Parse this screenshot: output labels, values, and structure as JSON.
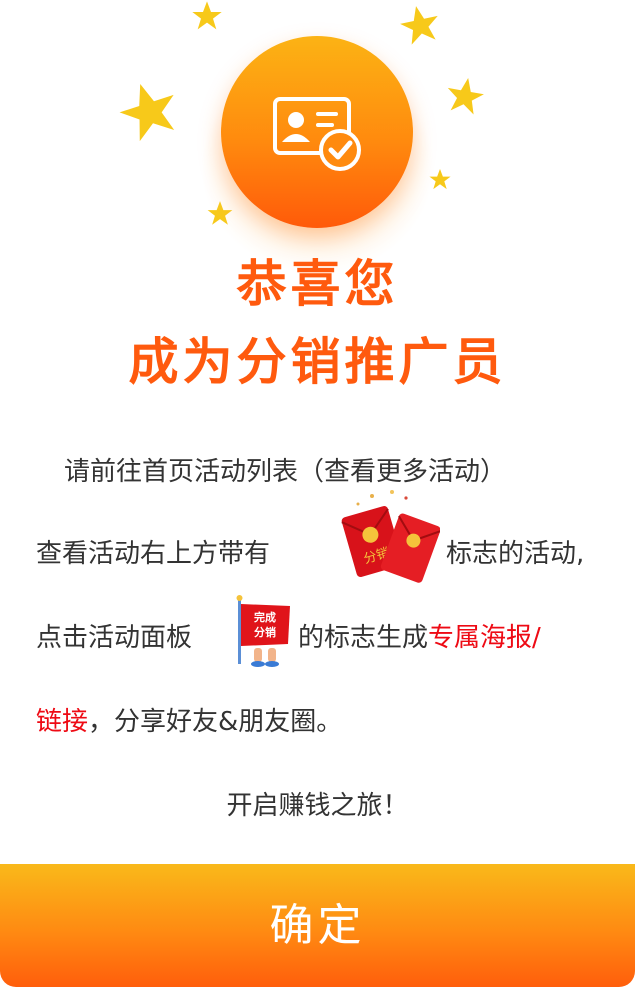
{
  "dialog": {
    "headline_line1": "恭喜您",
    "headline_line2": "成为分销推广员",
    "body": {
      "line1": "请前往首页活动列表（查看更多活动）",
      "line2_before_badge": "查看活动右上方带有",
      "line2_after_badge": "标志的活动,",
      "line3_before_badge": "点击活动面板",
      "line3_after_badge_plain": "的标志生成",
      "line3_after_badge_highlight": "专属海报/",
      "line4_highlight": "链接",
      "line4_plain": "，分享好友&朋友圈。",
      "line5": "开启赚钱之旅！"
    },
    "badges": {
      "red_packet_label": "分销",
      "complete_label_line1": "完成",
      "complete_label_line2": "分销"
    },
    "confirm_label": "确定"
  },
  "colors": {
    "accent_orange": "#ff5a0e",
    "highlight_red": "#ee0a14",
    "star_yellow": "#f7c91a",
    "button_gradient_top": "#f9b91a",
    "button_gradient_bottom": "#ff5e0c"
  },
  "icons": {
    "hero": "id-card-verified-icon",
    "stars": "star-icon",
    "red_packet_badge": "red-packet-icon",
    "complete_badge": "flag-icon"
  }
}
